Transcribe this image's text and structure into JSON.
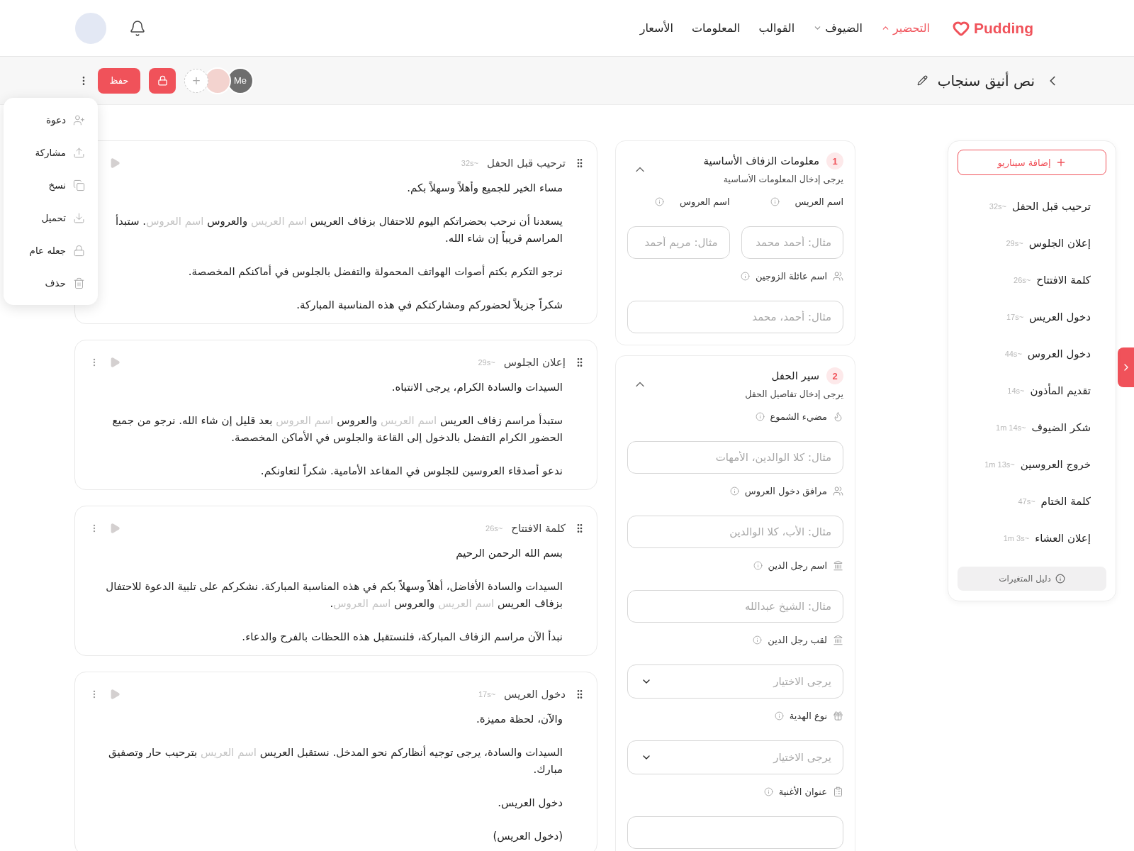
{
  "header": {
    "logo": "Pudding",
    "nav": [
      {
        "label": "التحضير",
        "kind": "dropdown",
        "selected": true
      },
      {
        "label": "الضيوف",
        "kind": "dropdown",
        "selected": false
      },
      {
        "label": "القوالب",
        "kind": "link",
        "selected": false
      },
      {
        "label": "المعلومات",
        "kind": "link",
        "selected": false
      },
      {
        "label": "الأسعار",
        "kind": "link",
        "selected": false
      }
    ]
  },
  "toolbar": {
    "title": "نص أنيق سنجاب",
    "me_avatar": "Me",
    "add_collaborator": "+",
    "save": "حفظ"
  },
  "menu": {
    "items": [
      "دعوة",
      "مشاركة",
      "نسخ",
      "تحميل",
      "جعله عام",
      "حذف"
    ]
  },
  "scripts": [
    {
      "title": "ترحيب قبل الحفل",
      "duration": "~32s",
      "paragraphs": [
        [
          {
            "text": "مساء الخير للجميع وأهلاً وسهلاً بكم.",
            "kind": "plain"
          }
        ],
        [
          {
            "text": "يسعدنا أن نرحب بحضراتكم اليوم للاحتفال بزفاف العريس ",
            "kind": "plain"
          },
          {
            "text": "اسم العريس",
            "kind": "variable"
          },
          {
            "text": " والعروس ",
            "kind": "plain"
          },
          {
            "text": "اسم العروس",
            "kind": "variable"
          },
          {
            "text": ". ستبدأ المراسم قريباً إن شاء الله.",
            "kind": "plain"
          }
        ],
        [
          {
            "text": "نرجو التكرم بكتم أصوات الهواتف المحمولة والتفضل بالجلوس في أماكنكم المخصصة.",
            "kind": "plain"
          }
        ],
        [
          {
            "text": "شكراً جزيلاً لحضوركم ومشاركتكم في هذه المناسبة المباركة.",
            "kind": "plain"
          }
        ]
      ]
    },
    {
      "title": "إعلان الجلوس",
      "duration": "~29s",
      "paragraphs": [
        [
          {
            "text": "السيدات والسادة الكرام، يرجى الانتباه.",
            "kind": "plain"
          }
        ],
        [
          {
            "text": "ستبدأ مراسم زفاف العريس ",
            "kind": "plain"
          },
          {
            "text": "اسم العريس",
            "kind": "variable"
          },
          {
            "text": " والعروس ",
            "kind": "plain"
          },
          {
            "text": "اسم العروس",
            "kind": "variable"
          },
          {
            "text": " بعد قليل إن شاء الله. نرجو من جميع الحضور الكرام التفضل بالدخول إلى القاعة والجلوس في الأماكن المخصصة.",
            "kind": "plain"
          }
        ],
        [
          {
            "text": "ندعو أصدقاء العروسين للجلوس في المقاعد الأمامية. شكراً لتعاونكم.",
            "kind": "plain"
          }
        ]
      ]
    },
    {
      "title": "كلمة الافتتاح",
      "duration": "~26s",
      "paragraphs": [
        [
          {
            "text": "بسم الله الرحمن الرحيم",
            "kind": "plain"
          }
        ],
        [
          {
            "text": "السيدات والسادة الأفاضل، أهلاً وسهلاً بكم في هذه المناسبة المباركة. نشكركم على تلبية الدعوة للاحتفال بزفاف العريس ",
            "kind": "plain"
          },
          {
            "text": "اسم العريس",
            "kind": "variable"
          },
          {
            "text": " والعروس ",
            "kind": "plain"
          },
          {
            "text": "اسم العروس",
            "kind": "variable"
          },
          {
            "text": ".",
            "kind": "plain"
          }
        ],
        [
          {
            "text": "نبدأ الآن مراسم الزفاف المباركة، فلنستقبل هذه اللحظات بالفرح والدعاء.",
            "kind": "plain"
          }
        ]
      ]
    },
    {
      "title": "دخول العريس",
      "duration": "~17s",
      "paragraphs": [
        [
          {
            "text": "والآن، لحظة مميزة.",
            "kind": "plain"
          }
        ],
        [
          {
            "text": "السيدات والسادة، يرجى توجيه أنظاركم نحو المدخل. نستقبل العريس ",
            "kind": "plain"
          },
          {
            "text": "اسم العريس",
            "kind": "variable"
          },
          {
            "text": " بترحيب حار وتصفيق مبارك.",
            "kind": "plain"
          }
        ],
        [
          {
            "text": "دخول العريس.",
            "kind": "plain"
          }
        ],
        [
          {
            "text": "(دخول العريس)",
            "kind": "plain"
          }
        ]
      ]
    }
  ],
  "sections": [
    {
      "number": "1",
      "title": "معلومات الزفاف الأساسية",
      "subtitle": "يرجى إدخال المعلومات الأساسية",
      "expanded": true,
      "rows": [
        [
          {
            "label": "اسم العريس",
            "kind": "input",
            "placeholder": "مثال: أحمد محمد"
          },
          {
            "label": "اسم العروس",
            "kind": "input",
            "placeholder": "مثال: مريم أحمد"
          }
        ],
        [
          {
            "label": "اسم عائلة الزوجين",
            "kind": "input",
            "placeholder": "مثال: أحمد، محمد"
          }
        ]
      ]
    },
    {
      "number": "2",
      "title": "سير الحفل",
      "subtitle": "يرجى إدخال تفاصيل الحفل",
      "expanded": true,
      "rows": [
        [
          {
            "label": "مضيء الشموع",
            "kind": "input",
            "placeholder": "مثال: كلا الوالدين، الأمهات"
          }
        ],
        [
          {
            "label": "مرافق دخول العروس",
            "kind": "input",
            "placeholder": "مثال: الأب، كلا الوالدين"
          }
        ],
        [
          {
            "label": "اسم رجل الدين",
            "kind": "input",
            "placeholder": "مثال: الشيخ عبدالله"
          }
        ],
        [
          {
            "label": "لقب رجل الدين",
            "kind": "select",
            "placeholder": "يرجى الاختيار"
          }
        ],
        [
          {
            "label": "نوع الهدية",
            "kind": "select",
            "placeholder": "يرجى الاختيار"
          }
        ],
        [
          {
            "label": "عنوان الأغنية",
            "kind": "input"
          }
        ]
      ]
    }
  ],
  "scenarios": {
    "add": "إضافة سيناريو",
    "items": [
      {
        "title": "ترحيب قبل الحفل",
        "duration": "~32s"
      },
      {
        "title": "إعلان الجلوس",
        "duration": "~29s"
      },
      {
        "title": "كلمة الافتتاح",
        "duration": "~26s"
      },
      {
        "title": "دخول العريس",
        "duration": "~17s"
      },
      {
        "title": "دخول العروس",
        "duration": "~44s"
      },
      {
        "title": "تقديم المأذون",
        "duration": "~14s"
      },
      {
        "title": "شكر الضيوف",
        "duration": "~1m 14s"
      },
      {
        "title": "خروج العروسين",
        "duration": "~1m 13s"
      },
      {
        "title": "كلمة الختام",
        "duration": "~47s"
      },
      {
        "title": "إعلان العشاء",
        "duration": "~1m 3s"
      }
    ],
    "guide": "دليل المتغيرات"
  }
}
